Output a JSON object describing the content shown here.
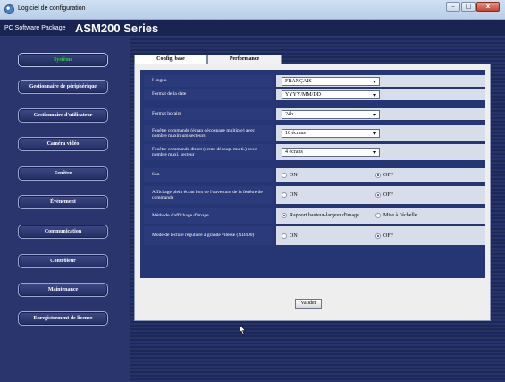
{
  "window": {
    "title": "Logiciel de configuration",
    "buttons": [
      "–",
      "□",
      "x"
    ]
  },
  "header": {
    "product_small": "PC Software Package",
    "product_big": "ASM200 Series"
  },
  "sidebar": {
    "items": [
      {
        "label": "Système",
        "active": true
      },
      {
        "label": "Gestionnaire de périphérique",
        "active": false
      },
      {
        "label": "Gestionnaire d'utilisateur",
        "active": false
      },
      {
        "label": "Caméra vidéo",
        "active": false
      },
      {
        "label": "Fenêtre",
        "active": false
      },
      {
        "label": "Événement",
        "active": false
      },
      {
        "label": "Communication",
        "active": false
      },
      {
        "label": "Contrôleur",
        "active": false
      },
      {
        "label": "Maintenance",
        "active": false
      },
      {
        "label": "Enregistrement de licence",
        "active": false
      }
    ]
  },
  "tabs": [
    {
      "label": "Config. base",
      "active": true
    },
    {
      "label": "Performance",
      "active": false
    }
  ],
  "settings": {
    "rows": [
      {
        "label": "Langue",
        "type": "select",
        "value": "FRANÇAIS"
      },
      {
        "label": "Format de la date",
        "type": "select",
        "value": "YYYY/MM/DD"
      },
      {
        "label": "Format horaire",
        "type": "select",
        "value": "24h"
      },
      {
        "label": "Fenêtre commande (écran découpage multiple) avec nombre maximum secteurs",
        "type": "select",
        "value": "16 écrans"
      },
      {
        "label": "Fenêtre commande direct (écran découp. multi.) avec nombre maxi. secteur",
        "type": "select",
        "value": "4 écrans"
      },
      {
        "label": "Son",
        "type": "radio",
        "options": [
          "ON",
          "OFF"
        ],
        "selected": 1
      },
      {
        "label": "Affichage plein écran lors de l'ouverture de la fenêtre de commande",
        "type": "radio",
        "options": [
          "ON",
          "OFF"
        ],
        "selected": 1
      },
      {
        "label": "Méthode d'affichage d'image",
        "type": "radio",
        "options": [
          "Rapport hauteur-largeur d'image",
          "Mise à l'échelle"
        ],
        "selected": 0
      },
      {
        "label": "Mode de lecture régulière à grande vitesse (ND400)",
        "type": "radio",
        "options": [
          "ON",
          "OFF"
        ],
        "selected": 1
      }
    ],
    "apply_label": "Valider"
  },
  "colors": {
    "active_sidebar_text": "#39c44a",
    "background": "#1f2a59",
    "panel_row": "#2b3a7a"
  }
}
